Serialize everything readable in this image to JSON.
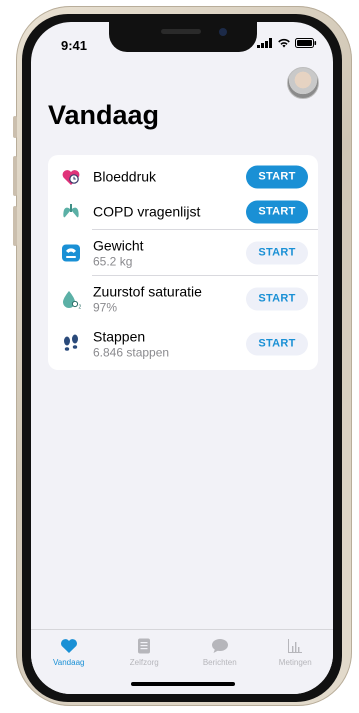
{
  "status_bar": {
    "time": "9:41"
  },
  "page": {
    "title": "Vandaag"
  },
  "items": [
    {
      "label": "Bloeddruk",
      "sub": "",
      "button": "START",
      "icon": "heart-clock-icon"
    },
    {
      "label": "COPD vragenlijst",
      "sub": "",
      "button": "START",
      "icon": "lungs-icon"
    },
    {
      "label": "Gewicht",
      "sub": "65.2 kg",
      "button": "START",
      "icon": "scale-icon"
    },
    {
      "label": "Zuurstof saturatie",
      "sub": "97%",
      "button": "START",
      "icon": "oxygen-drop-icon"
    },
    {
      "label": "Stappen",
      "sub": "6.846 stappen",
      "button": "START",
      "icon": "footsteps-icon"
    }
  ],
  "tabs": [
    {
      "label": "Vandaag",
      "icon": "heart-icon",
      "active": true
    },
    {
      "label": "Zelfzorg",
      "icon": "document-icon",
      "active": false
    },
    {
      "label": "Berichten",
      "icon": "chat-bubble-icon",
      "active": false
    },
    {
      "label": "Metingen",
      "icon": "bar-chart-icon",
      "active": false
    }
  ],
  "colors": {
    "accent": "#1a90d5",
    "heart": "#e0337a",
    "lungs": "#5bb0a6"
  }
}
